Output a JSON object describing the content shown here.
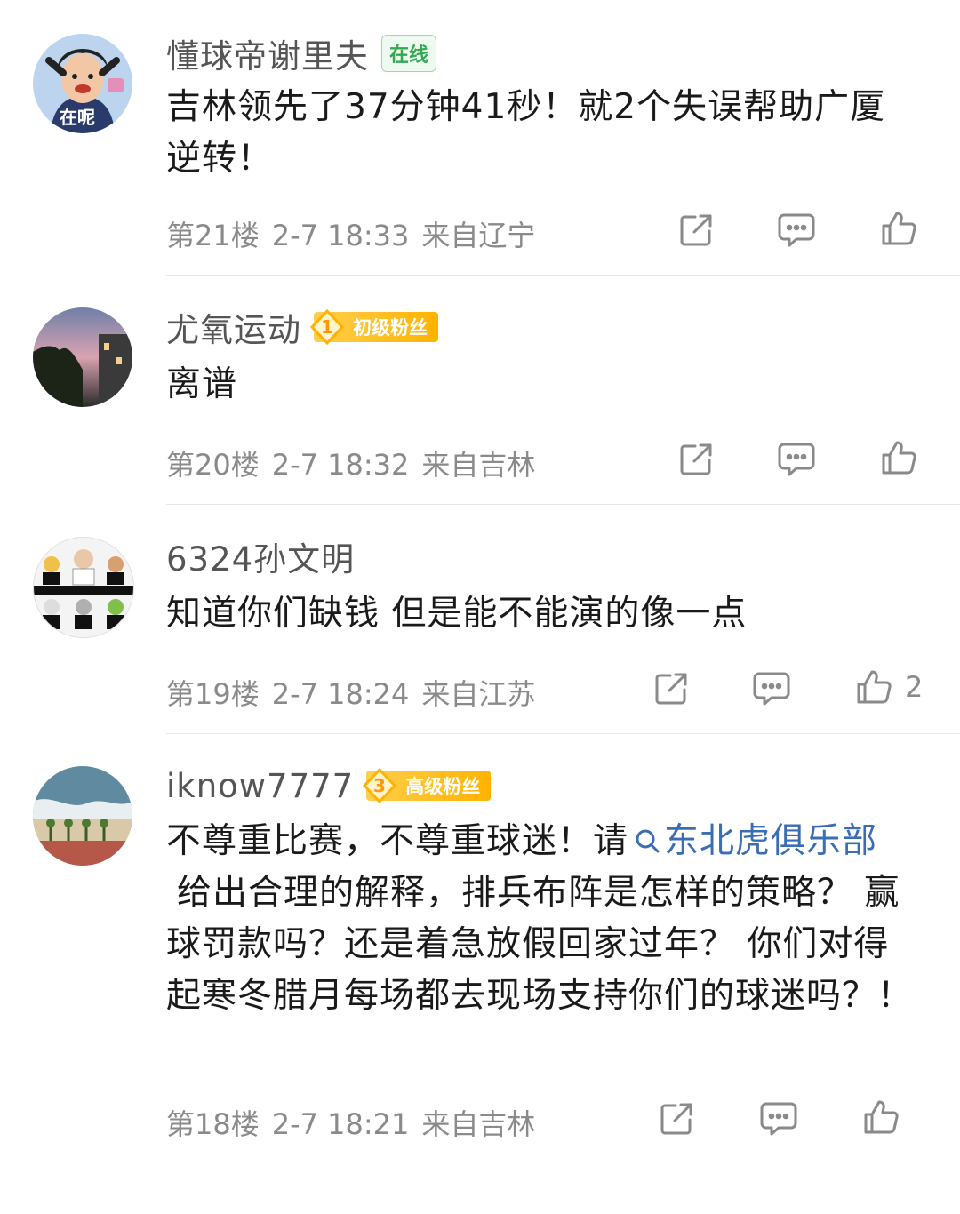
{
  "comments": [
    {
      "user": "懂球帝谢里夫",
      "tag": "在线",
      "avatar_caption": "在呢",
      "text": "吉林领先了37分钟41秒！就2个失误帮助广厦逆转！",
      "floor": "第21楼",
      "time": "2-7 18:33",
      "location": "来自辽宁",
      "likes": ""
    },
    {
      "user": "尤氧运动",
      "badge_level": "1",
      "badge_label": "初级粉丝",
      "text": "离谱",
      "floor": "第20楼",
      "time": "2-7 18:32",
      "location": "来自吉林",
      "likes": ""
    },
    {
      "user": "6324孙文明",
      "text": "知道你们缺钱 但是能不能演的像一点",
      "floor": "第19楼",
      "time": "2-7 18:24",
      "location": "来自江苏",
      "likes": "2"
    },
    {
      "user": "iknow7777",
      "badge_level": "3",
      "badge_label": "高级粉丝",
      "text_before": "不尊重比赛，不尊重球迷！请",
      "link": "东北虎俱乐部",
      "text_after": "给出合理的解释，排兵布阵是怎样的策略？ 赢球罚款吗？还是着急放假回家过年？ 你们对得起寒冬腊月每场都去现场支持你们的球迷吗？！",
      "floor": "第18楼",
      "time": "2-7 18:21",
      "location": "来自吉林",
      "likes": ""
    }
  ],
  "icons": [
    "share-icon",
    "comment-icon",
    "like-icon",
    "search-icon"
  ],
  "colors": {
    "link": "#3b6db3",
    "meta": "#8a8a8a",
    "badge": "#ffb300",
    "online": "#34a853"
  }
}
